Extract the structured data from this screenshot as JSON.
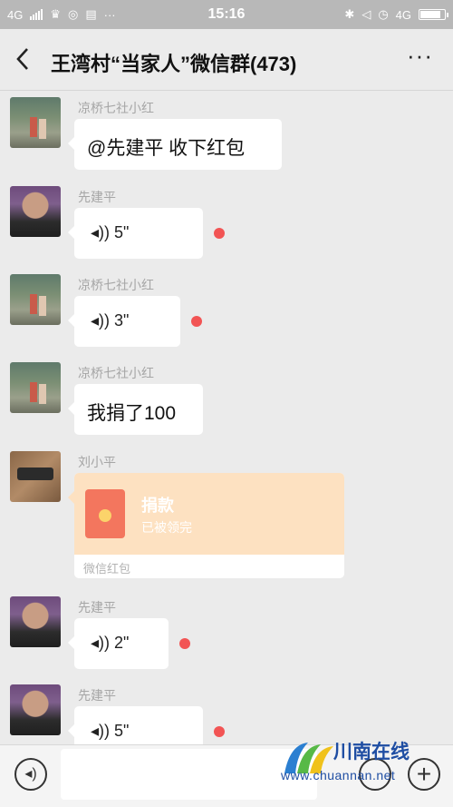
{
  "status_bar": {
    "network_left": "4G",
    "time": "15:16",
    "network_right": "4G",
    "battery_level": 0.85
  },
  "header": {
    "title": "王湾村“当家人”微信群(473)"
  },
  "messages": [
    {
      "sender": "凉桥七社小红",
      "type": "text",
      "text": "@先建平  收下红包"
    },
    {
      "sender": "先建平",
      "type": "voice",
      "duration": "5\"",
      "unread": true
    },
    {
      "sender": "凉桥七社小红",
      "type": "voice",
      "duration": "3\"",
      "unread": true
    },
    {
      "sender": "凉桥七社小红",
      "type": "text",
      "text": "我捐了100"
    },
    {
      "sender": "刘小平",
      "type": "red_packet",
      "title": "捐款",
      "status": "已被领完",
      "footer": "微信红包"
    },
    {
      "sender": "先建平",
      "type": "voice",
      "duration": "2\"",
      "unread": true
    },
    {
      "sender": "先建平",
      "type": "voice",
      "duration": "5\"",
      "unread": true
    }
  ],
  "watermark": {
    "name": "川南在线",
    "url": "www.chuannan.net"
  },
  "icons": {
    "back": "chevron-left-icon",
    "more": "more-dots-icon",
    "voice_msg": "voice-wave-icon",
    "voice_input": "voice-input-icon",
    "emoji": "emoji-icon",
    "plus": "plus-icon"
  },
  "colors": {
    "unread_dot": "#f25454",
    "red_packet_bg": "#fde1c1",
    "watermark": "#1f4ea3"
  }
}
